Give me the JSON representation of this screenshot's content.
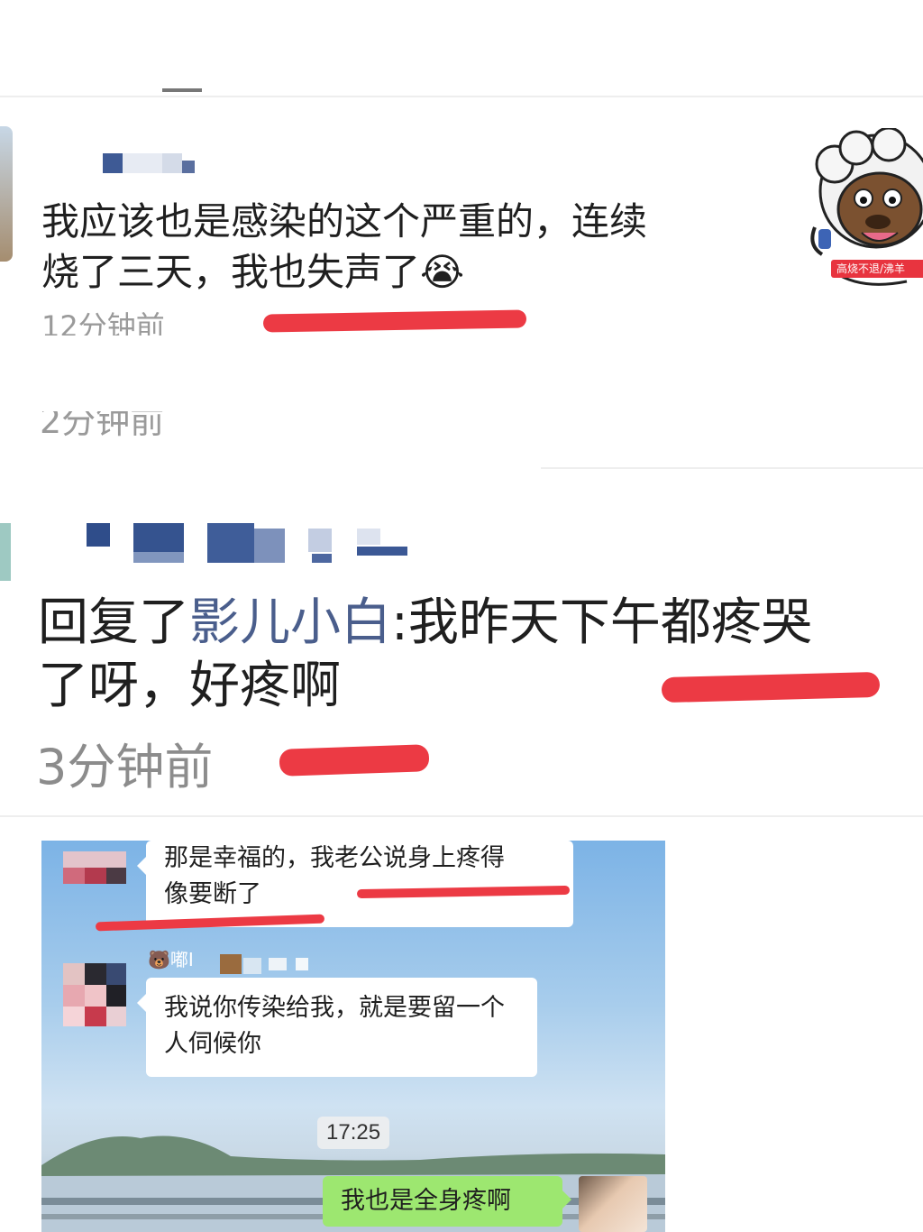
{
  "comment1": {
    "text_line1": "我应该也是感染的这个严重的，连续",
    "text_line2": "烧了三天，我也失声了",
    "emoji_label": "😭",
    "time": "12分钟前",
    "sticker_caption": "高烧不退/沸羊"
  },
  "comment2": {
    "time": "2分钟前"
  },
  "comment3": {
    "reply_prefix": "回复了",
    "reply_target": "影儿小白",
    "reply_colon": ":",
    "text_rest_line1": "我昨天下午都疼哭",
    "text_line2": "了呀，好疼啊",
    "time": "3分钟前"
  },
  "chat": {
    "message1_line1": "那是幸福的，我老公说身上疼得",
    "message1_line2": "像要断了",
    "sender2_emoji": "🐻",
    "sender2_name": "嘟I",
    "message2_line1": "我说你传染给我，就是要留一个",
    "message2_line2": "人伺候你",
    "timestamp": "17:25",
    "message3": "我也是全身疼啊"
  },
  "colors": {
    "annotation_red": "#ec3a44",
    "link_blue": "#4a5e8c",
    "time_gray": "#9a9a9a",
    "wechat_green": "#9de770"
  }
}
